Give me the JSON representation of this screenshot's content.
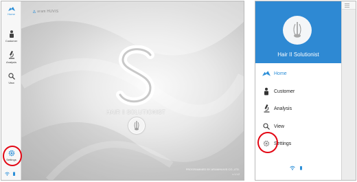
{
  "left_screen": {
    "brand": "aram HUVIS",
    "app_name": "HAIR Ⅱ SOLUTIONIST",
    "footer": "PROGRAMMED BY ARAMHUVIS CO.,LTD.",
    "version": "v 1.1.2",
    "rail": [
      {
        "id": "home",
        "label": "Home",
        "icon": "home-icon",
        "active": true
      },
      {
        "id": "customer",
        "label": "Customer",
        "icon": "person-icon"
      },
      {
        "id": "analysis",
        "label": "Analysis",
        "icon": "microscope-icon"
      },
      {
        "id": "view",
        "label": "View",
        "icon": "magnifier-icon"
      },
      {
        "id": "settings",
        "label": "Settings",
        "icon": "gear-icon",
        "highlighted": true
      }
    ]
  },
  "right_screen": {
    "title": "Hair II Solutionist",
    "menu": [
      {
        "id": "home",
        "label": "Home",
        "icon": "home-icon",
        "active": true
      },
      {
        "id": "customer",
        "label": "Customer",
        "icon": "person-icon"
      },
      {
        "id": "analysis",
        "label": "Analysis",
        "icon": "microscope-icon"
      },
      {
        "id": "view",
        "label": "View",
        "icon": "magnifier-icon"
      },
      {
        "id": "settings",
        "label": "Settings",
        "icon": "gear-icon",
        "highlighted": true
      }
    ]
  },
  "colors": {
    "accent": "#2c8fd8",
    "drawer_header": "#2e89d3",
    "highlight_ring": "#e30613"
  }
}
